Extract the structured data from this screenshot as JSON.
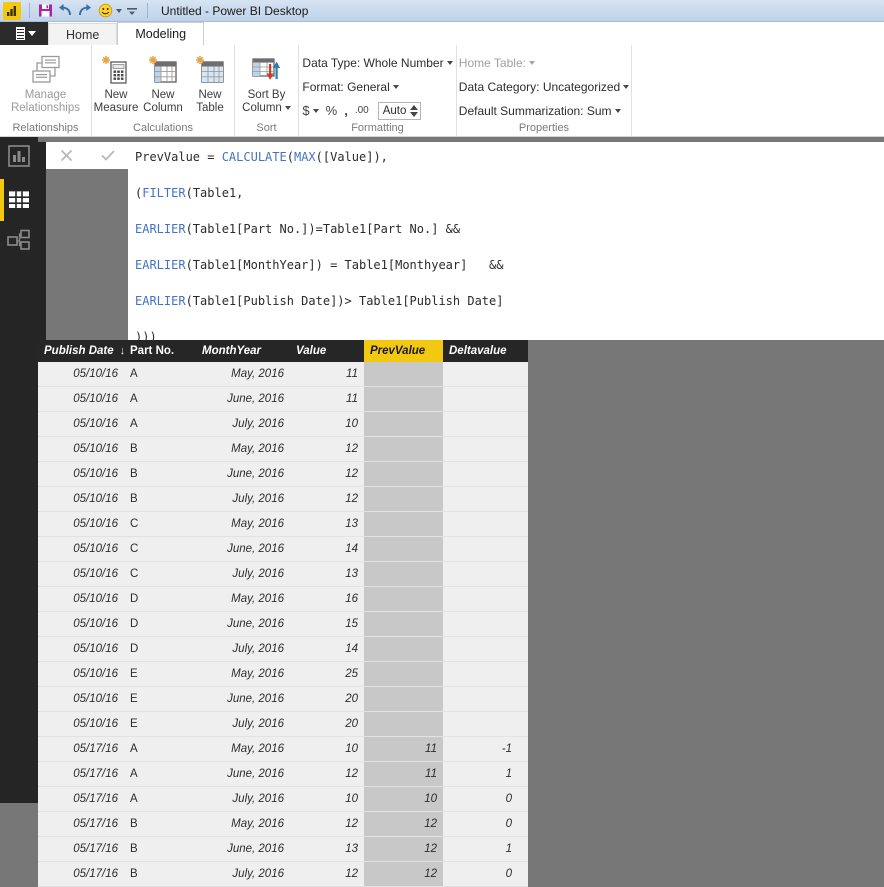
{
  "titlebar": {
    "title": "Untitled - Power BI Desktop",
    "qat": [
      {
        "name": "powerbi-logo-icon",
        "label": "Power BI"
      },
      {
        "name": "save-icon",
        "label": "Save"
      },
      {
        "name": "undo-icon",
        "label": "Undo"
      },
      {
        "name": "redo-icon",
        "label": "Redo"
      },
      {
        "name": "feedback-smiley-icon",
        "label": "Send a Smile"
      },
      {
        "name": "customize-quick-access-toolbar-icon",
        "label": "Customize Quick Access Toolbar"
      }
    ]
  },
  "tabs": {
    "file_label": "File",
    "items": [
      {
        "label": "Home",
        "active": false
      },
      {
        "label": "Modeling",
        "active": true
      }
    ]
  },
  "ribbon": {
    "groups": [
      {
        "name": "relationships",
        "label": "Relationships",
        "buttons": [
          {
            "label_line1": "Manage",
            "label_line2": "Relationships",
            "icon": "manage-relationships-icon",
            "disabled": true
          }
        ]
      },
      {
        "name": "calculations",
        "label": "Calculations",
        "buttons": [
          {
            "label_line1": "New",
            "label_line2": "Measure",
            "icon": "new-measure-icon"
          },
          {
            "label_line1": "New",
            "label_line2": "Column",
            "icon": "new-column-icon"
          },
          {
            "label_line1": "New",
            "label_line2": "Table",
            "icon": "new-table-icon"
          }
        ]
      },
      {
        "name": "sort",
        "label": "Sort",
        "buttons": [
          {
            "label_line1": "Sort By",
            "label_line2": "Column",
            "icon": "sort-by-column-icon",
            "has_dropdown": true
          }
        ]
      },
      {
        "name": "formatting",
        "label": "Formatting",
        "rows": [
          {
            "text": "Data Type: Whole Number",
            "dropdown": true
          },
          {
            "text": "Format: General",
            "dropdown": true
          }
        ],
        "format_buttons": [
          {
            "glyph": "$",
            "name": "currency-format-icon",
            "dropdown": true
          },
          {
            "glyph": "%",
            "name": "percent-format-icon",
            "dropdown": false
          },
          {
            "glyph": ",",
            "name": "thousands-separator-icon",
            "dropdown": false
          },
          {
            "glyph": ".00",
            "name": "decimal-places-icon",
            "dropdown": false
          }
        ],
        "decimal_value": "Auto"
      },
      {
        "name": "properties",
        "label": "Properties",
        "rows": [
          {
            "text": "Home Table:",
            "dropdown": true,
            "dim": true
          },
          {
            "text": "Data Category: Uncategorized",
            "dropdown": true
          },
          {
            "text": "Default Summarization: Sum",
            "dropdown": true
          }
        ]
      }
    ]
  },
  "leftnav": {
    "items": [
      {
        "name": "report-view",
        "icon": "bar-chart-icon",
        "active": false
      },
      {
        "name": "data-view",
        "icon": "table-grid-icon",
        "active": true
      },
      {
        "name": "relationships-view",
        "icon": "relationships-icon",
        "active": false
      }
    ]
  },
  "formula_bar": {
    "cancel_label": "✕",
    "commit_label": "✓",
    "lines": [
      [
        {
          "t": "PrevValue = ",
          "k": "plain"
        },
        {
          "t": "CALCULATE",
          "k": "fn"
        },
        {
          "t": "(",
          "k": "plain"
        },
        {
          "t": "MAX",
          "k": "fn"
        },
        {
          "t": "([Value]),",
          "k": "plain"
        }
      ],
      [
        {
          "t": "(",
          "k": "plain"
        },
        {
          "t": "FILTER",
          "k": "fn"
        },
        {
          "t": "(Table1,",
          "k": "plain"
        }
      ],
      [
        {
          "t": "EARLIER",
          "k": "fn"
        },
        {
          "t": "(Table1[Part No.])=Table1[Part No.] &&",
          "k": "plain"
        }
      ],
      [
        {
          "t": "EARLIER",
          "k": "fn"
        },
        {
          "t": "(Table1[MonthYear]) = Table1[Monthyear]   &&",
          "k": "plain"
        }
      ],
      [
        {
          "t": "EARLIER",
          "k": "fn"
        },
        {
          "t": "(Table1[Publish Date])> Table1[Publish Date]",
          "k": "plain"
        }
      ],
      [
        {
          "t": ")))",
          "k": "plain"
        }
      ]
    ]
  },
  "grid": {
    "columns": [
      {
        "label": "Publish Date",
        "key": "publish_date",
        "sorted": true,
        "sort_glyph": "↓",
        "highlight": false
      },
      {
        "label": "Part No.",
        "key": "part_no",
        "sorted": false,
        "highlight": false
      },
      {
        "label": "MonthYear",
        "key": "month_year",
        "sorted": false,
        "highlight": false
      },
      {
        "label": "Value",
        "key": "value",
        "sorted": false,
        "highlight": false
      },
      {
        "label": "PrevValue",
        "key": "prev_value",
        "sorted": false,
        "highlight": true
      },
      {
        "label": "Deltavalue",
        "key": "delta_value",
        "sorted": false,
        "highlight": false
      }
    ],
    "rows": [
      {
        "publish_date": "05/10/16",
        "part_no": "A",
        "month_year": "May, 2016",
        "value": "11",
        "prev_value": "",
        "delta_value": ""
      },
      {
        "publish_date": "05/10/16",
        "part_no": "A",
        "month_year": "June, 2016",
        "value": "11",
        "prev_value": "",
        "delta_value": ""
      },
      {
        "publish_date": "05/10/16",
        "part_no": "A",
        "month_year": "July, 2016",
        "value": "10",
        "prev_value": "",
        "delta_value": ""
      },
      {
        "publish_date": "05/10/16",
        "part_no": "B",
        "month_year": "May, 2016",
        "value": "12",
        "prev_value": "",
        "delta_value": ""
      },
      {
        "publish_date": "05/10/16",
        "part_no": "B",
        "month_year": "June, 2016",
        "value": "12",
        "prev_value": "",
        "delta_value": ""
      },
      {
        "publish_date": "05/10/16",
        "part_no": "B",
        "month_year": "July, 2016",
        "value": "12",
        "prev_value": "",
        "delta_value": ""
      },
      {
        "publish_date": "05/10/16",
        "part_no": "C",
        "month_year": "May, 2016",
        "value": "13",
        "prev_value": "",
        "delta_value": ""
      },
      {
        "publish_date": "05/10/16",
        "part_no": "C",
        "month_year": "June, 2016",
        "value": "14",
        "prev_value": "",
        "delta_value": ""
      },
      {
        "publish_date": "05/10/16",
        "part_no": "C",
        "month_year": "July, 2016",
        "value": "13",
        "prev_value": "",
        "delta_value": ""
      },
      {
        "publish_date": "05/10/16",
        "part_no": "D",
        "month_year": "May, 2016",
        "value": "16",
        "prev_value": "",
        "delta_value": ""
      },
      {
        "publish_date": "05/10/16",
        "part_no": "D",
        "month_year": "June, 2016",
        "value": "15",
        "prev_value": "",
        "delta_value": ""
      },
      {
        "publish_date": "05/10/16",
        "part_no": "D",
        "month_year": "July, 2016",
        "value": "14",
        "prev_value": "",
        "delta_value": ""
      },
      {
        "publish_date": "05/10/16",
        "part_no": "E",
        "month_year": "May, 2016",
        "value": "25",
        "prev_value": "",
        "delta_value": ""
      },
      {
        "publish_date": "05/10/16",
        "part_no": "E",
        "month_year": "June, 2016",
        "value": "20",
        "prev_value": "",
        "delta_value": ""
      },
      {
        "publish_date": "05/10/16",
        "part_no": "E",
        "month_year": "July, 2016",
        "value": "20",
        "prev_value": "",
        "delta_value": ""
      },
      {
        "publish_date": "05/17/16",
        "part_no": "A",
        "month_year": "May, 2016",
        "value": "10",
        "prev_value": "11",
        "delta_value": "-1"
      },
      {
        "publish_date": "05/17/16",
        "part_no": "A",
        "month_year": "June, 2016",
        "value": "12",
        "prev_value": "11",
        "delta_value": "1"
      },
      {
        "publish_date": "05/17/16",
        "part_no": "A",
        "month_year": "July, 2016",
        "value": "10",
        "prev_value": "10",
        "delta_value": "0"
      },
      {
        "publish_date": "05/17/16",
        "part_no": "B",
        "month_year": "May, 2016",
        "value": "12",
        "prev_value": "12",
        "delta_value": "0"
      },
      {
        "publish_date": "05/17/16",
        "part_no": "B",
        "month_year": "June, 2016",
        "value": "13",
        "prev_value": "12",
        "delta_value": "1"
      },
      {
        "publish_date": "05/17/16",
        "part_no": "B",
        "month_year": "July, 2016",
        "value": "12",
        "prev_value": "12",
        "delta_value": "0"
      }
    ]
  },
  "colors": {
    "brand_yellow": "#f2c811",
    "header_dark": "#262626",
    "selected_column": "#c8c8c8",
    "row_bg": "#efefef",
    "canvas_gray": "#777777",
    "dax_function": "#4472c4"
  }
}
